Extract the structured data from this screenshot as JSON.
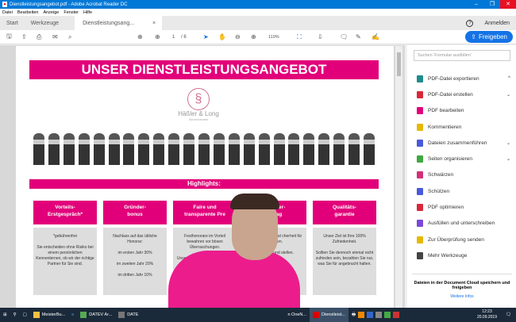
{
  "window": {
    "title": "Dienstleistungsangebot.pdf - Adobe Acrobat Reader DC"
  },
  "menu": [
    "Datei",
    "Bearbeiten",
    "Anzeige",
    "Fenster",
    "Hilfe"
  ],
  "tabs": {
    "start": "Start",
    "tools": "Werkzeuge",
    "doc": "Dienstleistungsang...",
    "close": "×",
    "help": "?",
    "signin": "Anmelden"
  },
  "toolbar": {
    "page_current": "1",
    "page_total": "/ 6",
    "zoom": "119%",
    "share": "Freigeben"
  },
  "doc": {
    "banner": "UNSER DIENSTLEISTUNGSANGEBOT",
    "logo_name": "Häßler & Long",
    "logo_sub": "Steuerberater",
    "highlights": "Highlights:",
    "cards": [
      {
        "title": "Vorteils-\nErstgespräch*",
        "body": "*gebührenfrei\n\nSie entscheiden ohne Risiko bei einem persönlichen Kennenlernen, ob wir der richtige Partner für Sie sind."
      },
      {
        "title": "Gründer-\nbonus",
        "body": "Nachlass auf das übliche Honorar:\n\nim ersten Jahr 30%\n\nim zweiten Jahr 20%\n\nim dritten Jahr 10%"
      },
      {
        "title": "Faire und\ntransparente Pre",
        "body": "Festhonorare im Vorteil bewahren vor bösen Überraschungen.\n\nUnsere Preise bieten Sicherheit und Transp"
      },
      {
        "title": "rberater-\nertrag",
        "body": "gel\" sind fixiert und cherheit für Parteien.\n\nrechnung und stellen."
      },
      {
        "title": "Qualitäts-\ngarantie",
        "body": "Unser Ziel ist Ihre 100% Zufriedenheit.\n\nSollten Sie dennoch einmal nicht zufrieden sein, bezahlen Sie nur, was Sie für angebracht halten."
      }
    ]
  },
  "panel": {
    "search_placeholder": "Suchen 'Formular ausfüllen'",
    "tools": [
      {
        "label": "PDF-Datei exportieren",
        "color": "#1e8c8c",
        "chevron": "^"
      },
      {
        "label": "PDF-Datei erstellen",
        "color": "#d9263a",
        "chevron": "⌄"
      },
      {
        "label": "PDF bearbeiten",
        "color": "#e2007a",
        "chevron": ""
      },
      {
        "label": "Kommentieren",
        "color": "#e8b800",
        "chevron": ""
      },
      {
        "label": "Dateien zusammenführen",
        "color": "#4a5ad8",
        "chevron": "⌄"
      },
      {
        "label": "Seiten organisieren",
        "color": "#3fa83f",
        "chevron": "⌄"
      },
      {
        "label": "Schwärzen",
        "color": "#d0307a",
        "chevron": ""
      },
      {
        "label": "Schützen",
        "color": "#4a5ad8",
        "chevron": ""
      },
      {
        "label": "PDF optimieren",
        "color": "#d9263a",
        "chevron": ""
      },
      {
        "label": "Ausfüllen und unterschreiben",
        "color": "#7a4ad8",
        "chevron": ""
      },
      {
        "label": "Zur Überprüfung senden",
        "color": "#e8b800",
        "chevron": ""
      },
      {
        "label": "Mehr Werkzeuge",
        "color": "#444444",
        "chevron": ""
      }
    ],
    "cloud_text": "Dateien in der Document Cloud speichern und freigeben",
    "cloud_link": "Weitere Infos"
  },
  "taskbar": {
    "apps": [
      "MeisterBu...",
      "DATEV Ar...",
      "DATE",
      "n OneN...",
      "Dienstleist..."
    ],
    "time": "12:23",
    "date": "20.09.2019"
  }
}
